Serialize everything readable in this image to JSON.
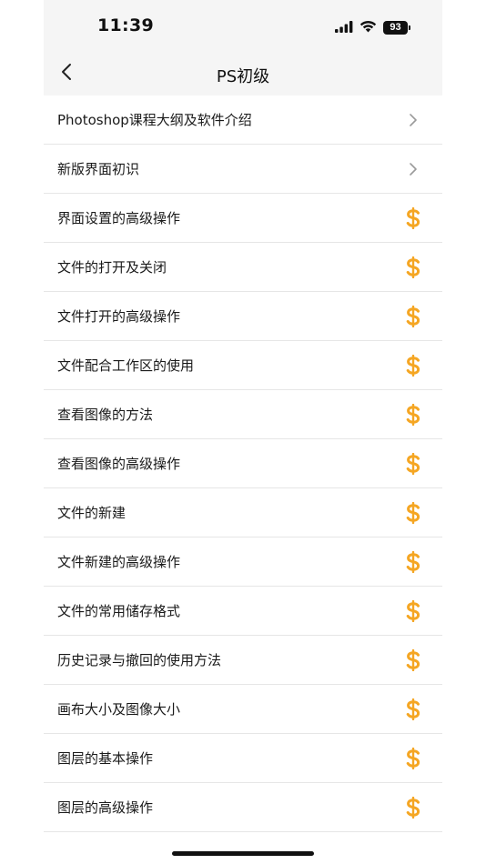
{
  "status_bar": {
    "time": "11:39",
    "battery": "93",
    "icons": [
      "cellular-signal-icon",
      "wifi-icon",
      "battery-icon"
    ]
  },
  "nav": {
    "title": "PS初级",
    "back_icon": "chevron-left-icon"
  },
  "colors": {
    "paid_icon": "#F5A623",
    "chevron": "#9a9a9a",
    "header_bg": "#f5f5f5"
  },
  "lessons": [
    {
      "label": "Photoshop课程大纲及软件介绍",
      "icon": "chevron-right-icon"
    },
    {
      "label": "新版界面初识",
      "icon": "chevron-right-icon"
    },
    {
      "label": "界面设置的高级操作",
      "icon": "dollar-icon"
    },
    {
      "label": "文件的打开及关闭",
      "icon": "dollar-icon"
    },
    {
      "label": "文件打开的高级操作",
      "icon": "dollar-icon"
    },
    {
      "label": "文件配合工作区的使用",
      "icon": "dollar-icon"
    },
    {
      "label": "查看图像的方法",
      "icon": "dollar-icon"
    },
    {
      "label": "查看图像的高级操作",
      "icon": "dollar-icon"
    },
    {
      "label": "文件的新建",
      "icon": "dollar-icon"
    },
    {
      "label": "文件新建的高级操作",
      "icon": "dollar-icon"
    },
    {
      "label": "文件的常用储存格式",
      "icon": "dollar-icon"
    },
    {
      "label": "历史记录与撤回的使用方法",
      "icon": "dollar-icon"
    },
    {
      "label": "画布大小及图像大小",
      "icon": "dollar-icon"
    },
    {
      "label": "图层的基本操作",
      "icon": "dollar-icon"
    },
    {
      "label": "图层的高级操作",
      "icon": "dollar-icon"
    }
  ]
}
